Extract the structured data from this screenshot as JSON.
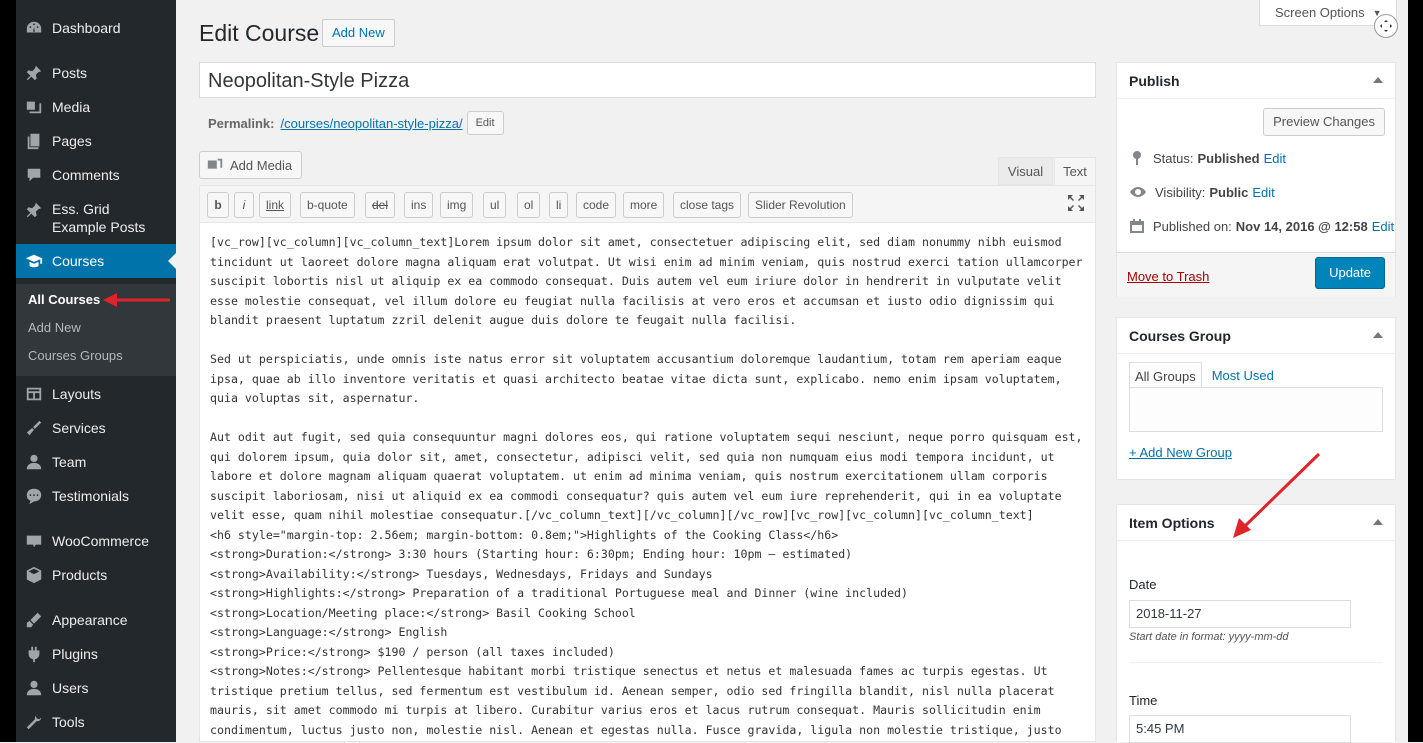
{
  "sidebar": {
    "items": [
      {
        "label": "Dashboard",
        "icon": "dashboard-icon"
      },
      {
        "label": "Posts",
        "icon": "pin-icon"
      },
      {
        "label": "Media",
        "icon": "media-icon"
      },
      {
        "label": "Pages",
        "icon": "pages-icon"
      },
      {
        "label": "Comments",
        "icon": "comments-icon"
      },
      {
        "label": "Ess. Grid Example Posts",
        "icon": "pin-icon"
      },
      {
        "label": "Courses",
        "icon": "courses-icon"
      },
      {
        "label": "Layouts",
        "icon": "layouts-icon"
      },
      {
        "label": "Services",
        "icon": "services-icon"
      },
      {
        "label": "Team",
        "icon": "team-icon"
      },
      {
        "label": "Testimonials",
        "icon": "testimonials-icon"
      },
      {
        "label": "WooCommerce",
        "icon": "woocommerce-icon"
      },
      {
        "label": "Products",
        "icon": "products-icon"
      },
      {
        "label": "Appearance",
        "icon": "appearance-icon"
      },
      {
        "label": "Plugins",
        "icon": "plugins-icon"
      },
      {
        "label": "Users",
        "icon": "users-icon"
      },
      {
        "label": "Tools",
        "icon": "tools-icon"
      }
    ],
    "submenu": [
      "All Courses",
      "Add New",
      "Courses Groups"
    ]
  },
  "header": {
    "title": "Edit Course",
    "add_new": "Add New",
    "screen_options": "Screen Options"
  },
  "post": {
    "title": "Neopolitan-Style Pizza",
    "permalink_label": "Permalink:",
    "permalink_url": "/courses/neopolitan-style-pizza/",
    "permalink_edit": "Edit"
  },
  "editor": {
    "add_media": "Add Media",
    "tab_visual": "Visual",
    "tab_text": "Text",
    "toolbar": [
      "b",
      "i",
      "link",
      "b-quote",
      "del",
      "ins",
      "img",
      "ul",
      "ol",
      "li",
      "code",
      "more",
      "close tags",
      "Slider Revolution"
    ],
    "content": "[vc_row][vc_column][vc_column_text]Lorem ipsum dolor sit amet, consectetuer adipiscing elit, sed diam nonummy nibh euismod tincidunt ut laoreet dolore magna aliquam erat volutpat. Ut wisi enim ad minim veniam, quis nostrud exerci tation ullamcorper suscipit lobortis nisl ut aliquip ex ea commodo consequat. Duis autem vel eum iriure dolor in hendrerit in vulputate velit esse molestie consequat, vel illum dolore eu feugiat nulla facilisis at vero eros et accumsan et iusto odio dignissim qui blandit praesent luptatum zzril delenit augue duis dolore te feugait nulla facilisi.\n\nSed ut perspiciatis, unde omnis iste natus error sit voluptatem accusantium doloremque laudantium, totam rem aperiam eaque ipsa, quae ab illo inventore veritatis et quasi architecto beatae vitae dicta sunt, explicabo. nemo enim ipsam voluptatem, quia voluptas sit, aspernatur.\n\nAut odit aut fugit, sed quia consequuntur magni dolores eos, qui ratione voluptatem sequi nesciunt, neque porro quisquam est, qui dolorem ipsum, quia dolor sit, amet, consectetur, adipisci velit, sed quia non numquam eius modi tempora incidunt, ut labore et dolore magnam aliquam quaerat voluptatem. ut enim ad minima veniam, quis nostrum exercitationem ullam corporis suscipit laboriosam, nisi ut aliquid ex ea commodi consequatur? quis autem vel eum iure reprehenderit, qui in ea voluptate velit esse, quam nihil molestiae consequatur.[/vc_column_text][/vc_column][/vc_row][vc_row][vc_column][vc_column_text]\n<h6 style=\"margin-top: 2.56em; margin-bottom: 0.8em;\">Highlights of the Cooking Class</h6>\n<strong>Duration:</strong> 3:30 hours (Starting hour: 6:30pm; Ending hour: 10pm – estimated)\n<strong>Availability:</strong> Tuesdays, Wednesdays, Fridays and Sundays\n<strong>Highlights:</strong> Preparation of a traditional Portuguese meal and Dinner (wine included)\n<strong>Location/Meeting place:</strong> Basil Cooking School\n<strong>Language:</strong> English\n<strong>Price:</strong> $190 / person (all taxes included)\n<strong>Notes:</strong> Pellentesque habitant morbi tristique senectus et netus et malesuada fames ac turpis egestas. Ut tristique pretium tellus, sed fermentum est vestibulum id. Aenean semper, odio sed fringilla blandit, nisl nulla placerat mauris, sit amet commodo mi turpis at libero. Curabitur varius eros et lacus rutrum consequat. Mauris sollicitudin enim condimentum, luctus justo non, molestie nisl. Aenean et egestas nulla. Fusce gravida, ligula non molestie tristique, justo"
  },
  "publish": {
    "title": "Publish",
    "preview": "Preview Changes",
    "status_label": "Status:",
    "status_value": "Published",
    "visibility_label": "Visibility:",
    "visibility_value": "Public",
    "published_label": "Published on:",
    "published_value": "Nov 14, 2016 @ 12:58",
    "edit": "Edit",
    "trash": "Move to Trash",
    "update": "Update"
  },
  "courses_group": {
    "title": "Courses Group",
    "tab_all": "All Groups",
    "tab_most": "Most Used",
    "add_new": "+ Add New Group"
  },
  "item_options": {
    "title": "Item Options",
    "date_label": "Date",
    "date_value": "2018-11-27",
    "date_hint": "Start date in format: yyyy-mm-dd",
    "time_label": "Time",
    "time_value": "5:45 PM"
  },
  "colors": {
    "sidebar_bg": "#23282d",
    "sidebar_active": "#0073aa",
    "link": "#0073aa",
    "primary_button": "#0085ba",
    "trash": "#a00",
    "annotation_arrow": "#e0242a"
  }
}
